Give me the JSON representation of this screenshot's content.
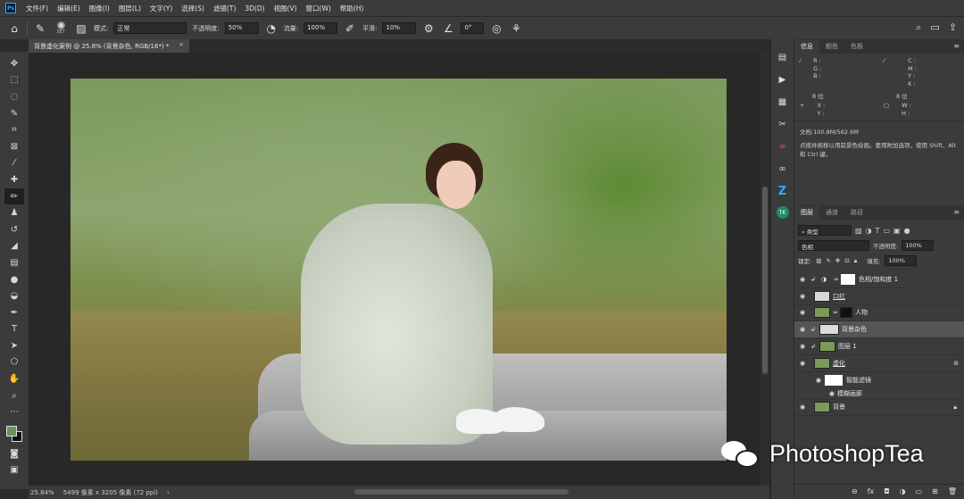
{
  "menubar": {
    "logo": "Ps",
    "items": [
      "文件(F)",
      "编辑(E)",
      "图像(I)",
      "图层(L)",
      "文字(Y)",
      "选择(S)",
      "滤镜(T)",
      "3D(D)",
      "视图(V)",
      "窗口(W)",
      "帮助(H)"
    ]
  },
  "options": {
    "brush_size": "387",
    "mode_label": "模式:",
    "mode_value": "正常",
    "opacity_label": "不透明度:",
    "opacity_value": "50%",
    "flow_label": "流量:",
    "flow_value": "100%",
    "smooth_label": "平滑:",
    "smooth_value": "10%",
    "angle_value": "0°"
  },
  "document_tab": {
    "title": "背景虚化案例 @ 25.8% (背景杂色, RGB/16*) *",
    "close": "×"
  },
  "status": {
    "zoom": "25.84%",
    "doc_size": "5499 像素 x 3205 像素 (72 ppi)",
    "arrow": "›"
  },
  "info_panel": {
    "tabs": [
      "信息",
      "颜色",
      "色板"
    ],
    "rgb_letters": [
      "R :",
      "G :",
      "B :"
    ],
    "cmyk_letters": [
      "C :",
      "M :",
      "Y :",
      "K :"
    ],
    "bits_left": "8 位",
    "bits_right": "8 位",
    "xy_letters": [
      "X :",
      "Y :"
    ],
    "wh_letters": [
      "W :",
      "H :"
    ],
    "doc_info": "文档:100.8M/562.6M",
    "hint": "点按并拖移以用前景色绘画。要用附加选项，使用 Shift、Alt 和 Ctrl 键。"
  },
  "layers_panel": {
    "tabs": [
      "图层",
      "通道",
      "路径"
    ],
    "filter_kind": "类型",
    "blend_mode": "色相",
    "opacity_label": "不透明度:",
    "opacity_value": "100%",
    "lock_label": "锁定:",
    "fill_label": "填充:",
    "fill_value": "100%",
    "layers": [
      {
        "name": "色相/饱和度 1",
        "type": "adjustment"
      },
      {
        "name": "口红",
        "type": "pixel"
      },
      {
        "name": "人物",
        "type": "masked"
      },
      {
        "name": "背景杂色",
        "type": "clipped",
        "selected": true
      },
      {
        "name": "图层 1",
        "type": "clipped"
      },
      {
        "name": "虚化",
        "type": "smart"
      },
      {
        "name": "智能滤镜",
        "type": "filter-mask"
      },
      {
        "name": "模糊画廊",
        "type": "filter"
      },
      {
        "name": "背景",
        "type": "background"
      }
    ]
  },
  "watermark": {
    "text": "PhotoshopTea"
  },
  "colors": {
    "foreground": "#6f8f5e",
    "background": "#111111",
    "accent": "#31a8ff"
  }
}
